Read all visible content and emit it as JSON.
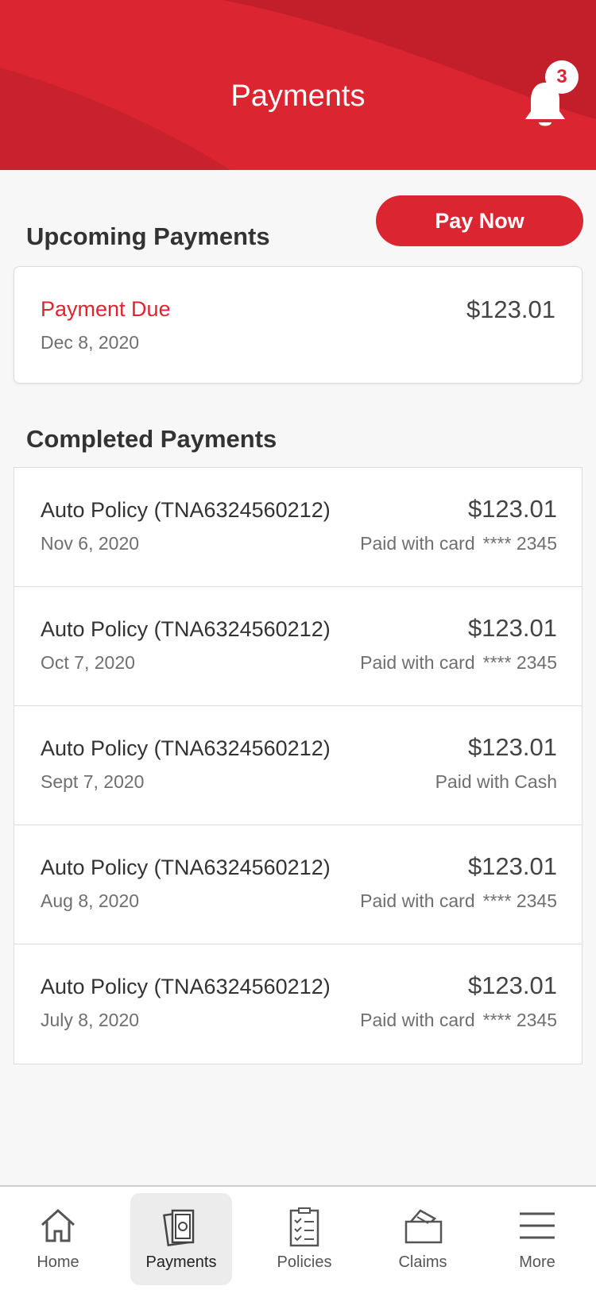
{
  "colors": {
    "brand": "#db2632",
    "brand_dark": "#c21f2b",
    "background": "#f7f7f7"
  },
  "header": {
    "title": "Payments",
    "notification_count": "3",
    "bell_icon": "bell-icon"
  },
  "upcoming": {
    "section_title": "Upcoming Payments",
    "pay_now_label": "Pay Now",
    "due_label": "Payment Due",
    "due_date": "Dec 8, 2020",
    "due_amount": "$123.01"
  },
  "completed": {
    "section_title": "Completed Payments",
    "rows": [
      {
        "title": "Auto Policy (TNA6324560212)",
        "date": "Nov 6, 2020",
        "amount": "$123.01",
        "method": "Paid with card",
        "card": "**** 2345"
      },
      {
        "title": "Auto Policy (TNA6324560212)",
        "date": "Oct 7, 2020",
        "amount": "$123.01",
        "method": "Paid with card",
        "card": "**** 2345"
      },
      {
        "title": "Auto Policy (TNA6324560212)",
        "date": "Sept 7, 2020",
        "amount": "$123.01",
        "method": "Paid with Cash",
        "card": ""
      },
      {
        "title": "Auto Policy (TNA6324560212)",
        "date": "Aug 8, 2020",
        "amount": "$123.01",
        "method": "Paid with card",
        "card": "**** 2345"
      },
      {
        "title": "Auto Policy (TNA6324560212)",
        "date": "July 8, 2020",
        "amount": "$123.01",
        "method": "Paid with card",
        "card": "**** 2345"
      }
    ]
  },
  "nav": {
    "items": [
      {
        "label": "Home",
        "icon": "home-icon"
      },
      {
        "label": "Payments",
        "icon": "payments-icon",
        "active": true
      },
      {
        "label": "Policies",
        "icon": "policies-icon"
      },
      {
        "label": "Claims",
        "icon": "claims-icon"
      },
      {
        "label": "More",
        "icon": "menu-icon"
      }
    ]
  }
}
